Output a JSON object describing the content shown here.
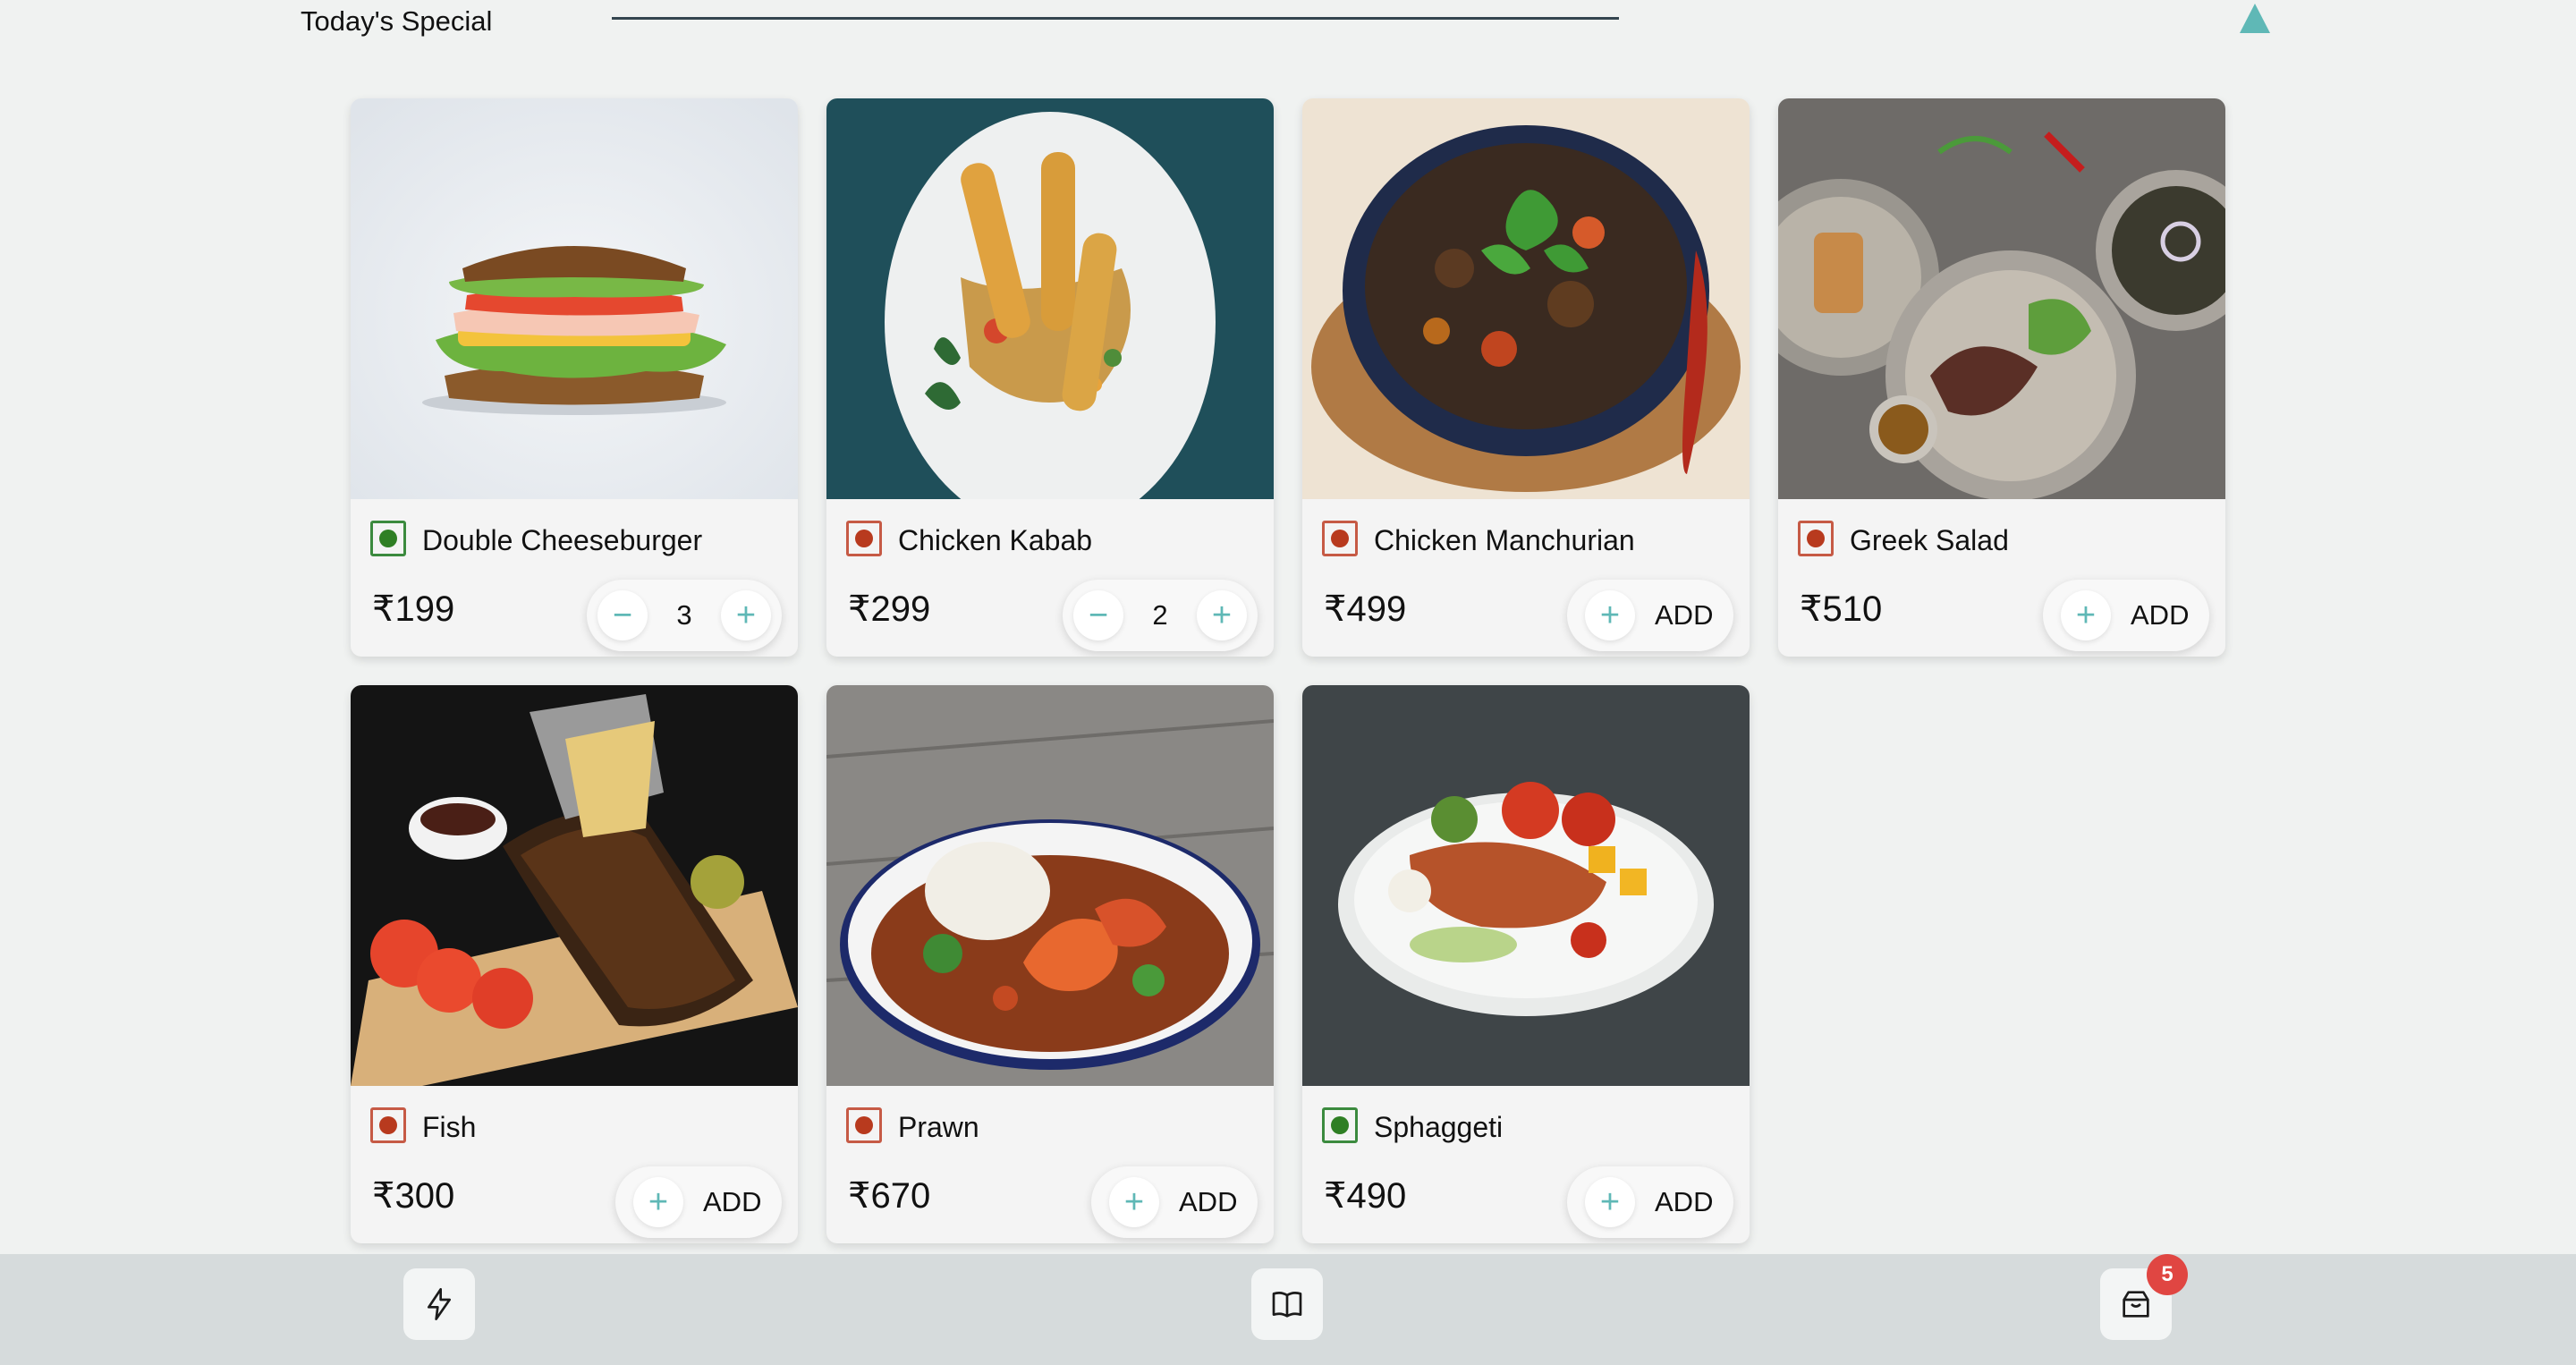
{
  "section": {
    "title": "Today's Special"
  },
  "currency": "₹",
  "add_label": "ADD",
  "colors": {
    "accent": "#5fb8b6",
    "veg": "#2f7f24",
    "nonveg": "#b83a1e",
    "badge": "#e04642"
  },
  "dishes": [
    {
      "name": "Double Cheeseburger",
      "price": "₹199",
      "diet": "veg",
      "in_cart": true,
      "quantity": "3",
      "image": "sandwich"
    },
    {
      "name": "Chicken Kabab",
      "price": "₹299",
      "diet": "nonveg",
      "in_cart": true,
      "quantity": "2",
      "image": "kabab"
    },
    {
      "name": "Chicken Manchurian",
      "price": "₹499",
      "diet": "nonveg",
      "in_cart": false,
      "image": "manchurian"
    },
    {
      "name": "Greek Salad",
      "price": "₹510",
      "diet": "nonveg",
      "in_cart": false,
      "image": "salad"
    },
    {
      "name": "Fish",
      "price": "₹300",
      "diet": "nonveg",
      "in_cart": false,
      "image": "ribs"
    },
    {
      "name": "Prawn",
      "price": "₹670",
      "diet": "nonveg",
      "in_cart": false,
      "image": "prawn"
    },
    {
      "name": "Sphaggeti",
      "price": "₹490",
      "diet": "veg",
      "in_cart": false,
      "image": "grill"
    }
  ],
  "bottom_nav": {
    "items": [
      {
        "icon": "lightning-icon"
      },
      {
        "icon": "menu-book-icon"
      },
      {
        "icon": "cart-icon"
      }
    ],
    "cart_count": "5"
  }
}
